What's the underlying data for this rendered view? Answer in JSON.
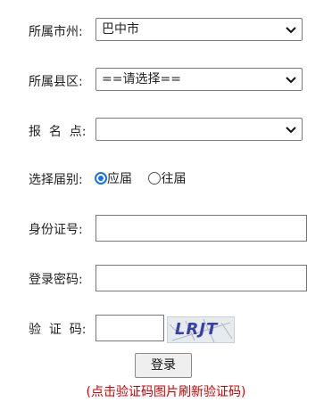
{
  "form": {
    "city": {
      "label": "所属市州:",
      "value": "巴中市"
    },
    "county": {
      "label": "所属县区:",
      "value": "==请选择=="
    },
    "site": {
      "label": "报  名  点:",
      "value": ""
    },
    "session": {
      "label": "选择届别:",
      "options": [
        "应届",
        "往届"
      ],
      "selected": "应届"
    },
    "id_number": {
      "label": "身份证号:",
      "value": ""
    },
    "password": {
      "label": "登录密码:",
      "value": ""
    },
    "captcha": {
      "label": "验  证  码:",
      "value": "",
      "image_text": "LRJT"
    },
    "login_button": "登录",
    "hint": "(点击验证码图片刷新验证码)"
  },
  "icons": {
    "dropdown": "chevron-down-icon"
  },
  "colors": {
    "hint": "#d00000",
    "radio_selected": "#1a73e8"
  }
}
